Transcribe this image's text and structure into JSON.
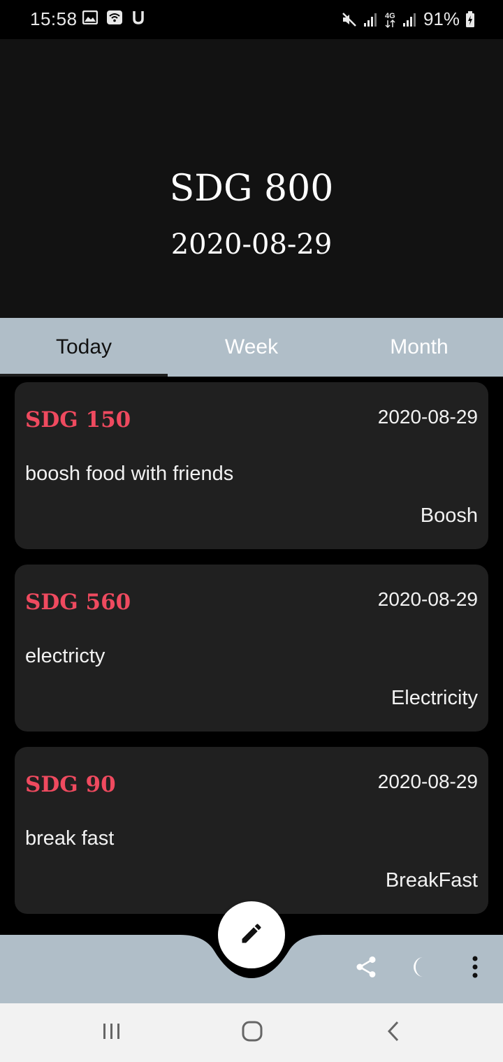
{
  "status_bar": {
    "time": "15:58",
    "battery": "91%",
    "icons": [
      "image-icon",
      "wifi-icon",
      "u-icon",
      "mute-icon",
      "signal-icon",
      "4g-icon",
      "signal-icon",
      "battery-icon"
    ]
  },
  "header": {
    "total_amount": "SDG 800",
    "date": "2020-08-29"
  },
  "tabs": [
    {
      "label": "Today",
      "active": true
    },
    {
      "label": "Week",
      "active": false
    },
    {
      "label": "Month",
      "active": false
    }
  ],
  "expenses": [
    {
      "amount": "SDG 150",
      "date": "2020-08-29",
      "description": "boosh food with friends",
      "category": "Boosh"
    },
    {
      "amount": "SDG 560",
      "date": "2020-08-29",
      "description": "electricty",
      "category": "Electricity"
    },
    {
      "amount": "SDG 90",
      "date": "2020-08-29",
      "description": "break fast",
      "category": "BreakFast"
    }
  ],
  "bottom_bar": {
    "fab_icon": "pencil-icon",
    "actions": [
      "share-icon",
      "moon-icon",
      "more-vert-icon"
    ]
  },
  "nav_bar": {
    "buttons": [
      "recents-icon",
      "home-icon",
      "back-icon"
    ]
  },
  "colors": {
    "header_bg": "#121212",
    "tab_bar_bg": "#b0bec8",
    "card_bg": "#202020",
    "amount_accent": "#ef4a5f"
  }
}
